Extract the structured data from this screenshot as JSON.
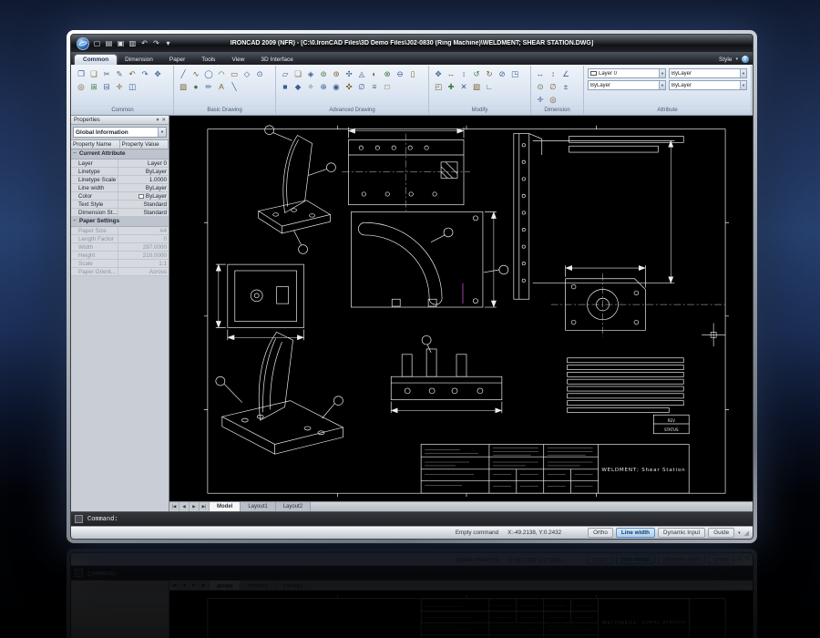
{
  "ui": {
    "chevron_down": "▾",
    "pin": "▾",
    "close": "✕",
    "help": "?",
    "collapse": "−",
    "grip": "◢"
  },
  "window": {
    "title": "IRONCAD 2009  (NFR) - [C:\\0.IronCAD Files\\3D Demo Files\\J02-0830 (Ring Machine)\\WELDMENT; SHEAR STATION.DWG]",
    "qat_icons": [
      {
        "name": "new-file-icon",
        "glyph": "▢"
      },
      {
        "name": "open-file-icon",
        "glyph": "▤"
      },
      {
        "name": "save-icon",
        "glyph": "▣"
      },
      {
        "name": "print-icon",
        "glyph": "▥"
      },
      {
        "name": "undo-icon",
        "glyph": "↶"
      },
      {
        "name": "redo-icon",
        "glyph": "↷"
      },
      {
        "name": "qat-menu-icon",
        "glyph": "▾"
      }
    ]
  },
  "ribbon": {
    "tabs": [
      {
        "label": "Common",
        "active": true
      },
      {
        "label": "Dimension"
      },
      {
        "label": "Paper"
      },
      {
        "label": "Tools"
      },
      {
        "label": "View"
      },
      {
        "label": "3D Interface"
      }
    ],
    "style_label": "Style",
    "groups": [
      {
        "label": "Common",
        "icons": [
          "❐",
          "❑",
          "✂",
          "✎",
          "↶",
          "↷",
          "✥",
          "◎",
          "⊞",
          "⊟",
          "✛",
          "◫"
        ]
      },
      {
        "label": "Basic Drawing",
        "icons": [
          "╱",
          "∿",
          "◯",
          "◠",
          "▭",
          "◇",
          "⊙",
          "▨",
          "●",
          "✏",
          "A",
          "╲"
        ]
      },
      {
        "label": "Advanced Drawing",
        "icons": [
          "▱",
          "❏",
          "◈",
          "⊚",
          "⊛",
          "✣",
          "◬",
          "◐",
          "⊗",
          "⊖",
          "▯",
          "■",
          "◆",
          "✧",
          "⊕",
          "◉",
          "✜",
          "∅",
          "≡",
          "□"
        ]
      },
      {
        "label": "Modify",
        "icons": [
          "✥",
          "↔",
          "↕",
          "↺",
          "↻",
          "⊘",
          "◳",
          "◰",
          "✚",
          "✕",
          "▧",
          "∟"
        ]
      },
      {
        "label": "Dimension",
        "icons": [
          "↔",
          "↕",
          "∠",
          "⊙",
          "∅",
          "±",
          "✛",
          "◎"
        ]
      },
      {
        "label": "Attribute",
        "combos": [
          {
            "value": "Layer 0",
            "swatch": true
          },
          {
            "value": "ByLayer"
          },
          {
            "value": "ByLayer"
          },
          {
            "value": "ByLayer"
          }
        ]
      }
    ]
  },
  "properties": {
    "panel_title": "Properties",
    "selector": "Global Information",
    "columns": [
      "Property Name",
      "Property Value"
    ],
    "current_attribute": {
      "label": "Current Attribute",
      "rows": [
        {
          "name": "Layer",
          "value": "Layer 0"
        },
        {
          "name": "Linetype",
          "value": "ByLayer"
        },
        {
          "name": "Linetype Scale",
          "value": "1.0000"
        },
        {
          "name": "Line width",
          "value": "ByLayer"
        },
        {
          "name": "Color",
          "value": "ByLayer",
          "swatch": true
        },
        {
          "name": "Text Style",
          "value": "Standard"
        },
        {
          "name": "Dimension St...",
          "value": "Standard"
        }
      ]
    },
    "paper_settings": {
      "label": "Paper Settings",
      "rows": [
        {
          "name": "Paper Size",
          "value": "A4"
        },
        {
          "name": "Length Factor",
          "value": "0"
        },
        {
          "name": "Width",
          "value": "297.0000"
        },
        {
          "name": "Height",
          "value": "210.0000"
        },
        {
          "name": "Scale",
          "value": "1:1"
        },
        {
          "name": "Paper Orient...",
          "value": "Across"
        }
      ]
    }
  },
  "drawing": {
    "title_block_title": "WELDMENT; Shear Station",
    "rev_label": "REV",
    "status_label": "STATUS"
  },
  "sheet_nav": [
    {
      "name": "first-sheet-icon",
      "glyph": "|◀"
    },
    {
      "name": "prev-sheet-icon",
      "glyph": "◀"
    },
    {
      "name": "next-sheet-icon",
      "glyph": "▶"
    },
    {
      "name": "last-sheet-icon",
      "glyph": "▶|"
    }
  ],
  "sheet_tabs": [
    {
      "label": "Model",
      "active": true
    },
    {
      "label": "Layout1"
    },
    {
      "label": "Layout2"
    }
  ],
  "command_line": {
    "prompt": "Command:"
  },
  "status_bar": {
    "message": "Empty command",
    "coordinates": "X:-49.2138, Y:0.2432",
    "toggles": [
      {
        "label": "Ortho"
      },
      {
        "label": "Line width",
        "active": true
      },
      {
        "label": "Dynamic Input"
      },
      {
        "label": "Guide"
      }
    ]
  }
}
